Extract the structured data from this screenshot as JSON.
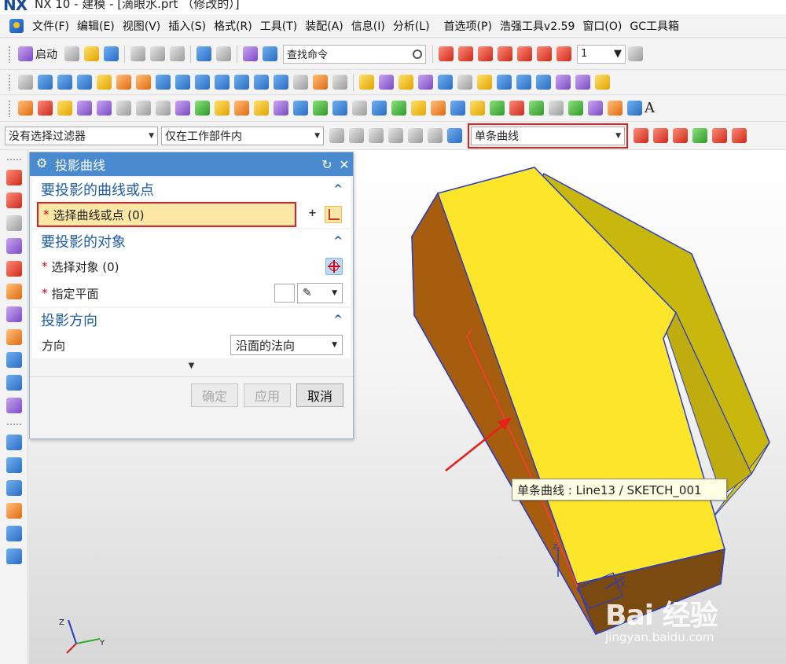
{
  "window": {
    "logo": "NX",
    "title": "NX 10 - 建模 - [滴眼水.prt （修改的）]"
  },
  "menubar": {
    "items": [
      {
        "label": "文件(F)"
      },
      {
        "label": "编辑(E)"
      },
      {
        "label": "视图(V)"
      },
      {
        "label": "插入(S)"
      },
      {
        "label": "格式(R)"
      },
      {
        "label": "工具(T)"
      },
      {
        "label": "装配(A)"
      },
      {
        "label": "信息(I)"
      },
      {
        "label": "分析(L)"
      },
      {
        "label": "首选项(P)"
      },
      {
        "label": "浩强工具v2.59"
      },
      {
        "label": "窗口(O)"
      },
      {
        "label": "GC工具箱"
      }
    ]
  },
  "toolbar1": {
    "start_label": "启动",
    "search_placeholder": "查找命令",
    "number_value": "1"
  },
  "selection_bar": {
    "filter_value": "没有选择过滤器",
    "scope_value": "仅在工作部件内",
    "curve_rule_value": "单条曲线",
    "curve_rule_highlight_color": "#e02020"
  },
  "dialog": {
    "title": "投影曲线",
    "reset_icon": "↻",
    "close_icon": "✕",
    "sections": {
      "curves": {
        "title": "要投影的曲线或点",
        "select_label": "选择曲线或点 (0)"
      },
      "objects": {
        "title": "要投影的对象",
        "select_label": "选择对象 (0)",
        "plane_label": "指定平面"
      },
      "direction": {
        "title": "投影方向",
        "direction_label": "方向",
        "direction_value": "沿面的法向"
      }
    },
    "more_glyph": "▼",
    "buttons": {
      "ok": "确定",
      "apply": "应用",
      "cancel": "取消"
    }
  },
  "tooltip": {
    "text": "单条曲线 : Line13 / SKETCH_001"
  },
  "watermark": {
    "brand": "Bai 经验",
    "url": "jingyan.baidu.com"
  },
  "model": {
    "top_face_color": "#fde62a",
    "side_face_color": "#b86c12",
    "inner_wall_color": "#c8b80e",
    "edge_color": "#2a3cc8",
    "highlight_curve_color": "#ff3a3a"
  }
}
